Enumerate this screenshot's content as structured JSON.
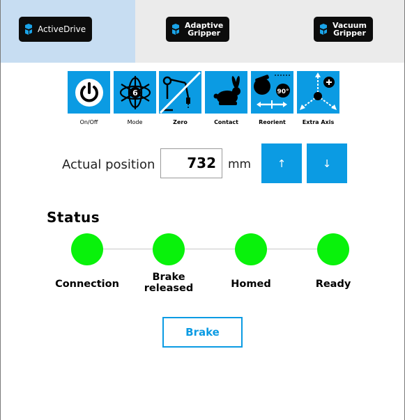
{
  "tabs": [
    {
      "label": "ActiveDrive",
      "active": true,
      "icon": "robotiq-logo-icon"
    },
    {
      "label": "Adaptive\nGripper",
      "active": false,
      "icon": "robotiq-logo-icon"
    },
    {
      "label": "Vacuum\nGripper",
      "active": false,
      "icon": "robotiq-logo-icon"
    }
  ],
  "tools": [
    {
      "label": "On/Off",
      "icon": "power-icon"
    },
    {
      "label": "Mode",
      "icon": "six-axis-mode-icon"
    },
    {
      "label": "Zero",
      "icon": "zero-robot-arm-icon"
    },
    {
      "label": "Contact",
      "icon": "rabbit-contact-icon"
    },
    {
      "label": "Reorient",
      "icon": "reorient-90-icon",
      "badge": "90°"
    },
    {
      "label": "Extra Axis",
      "icon": "extra-axis-icon"
    }
  ],
  "position": {
    "label": "Actual position",
    "value": "732",
    "unit": "mm",
    "up_symbol": "↑",
    "down_symbol": "↓"
  },
  "status": {
    "title": "Status",
    "indicators": [
      {
        "label": "Connection",
        "state": "on"
      },
      {
        "label": "Brake\nreleased",
        "state": "on"
      },
      {
        "label": "Homed",
        "state": "on"
      },
      {
        "label": "Ready",
        "state": "on"
      }
    ]
  },
  "brake_button": "Brake",
  "colors": {
    "accent": "#0b9be3",
    "active_tab": "#c7ddf2",
    "tab_bar": "#ebebeb",
    "led_on": "#09f20b"
  }
}
